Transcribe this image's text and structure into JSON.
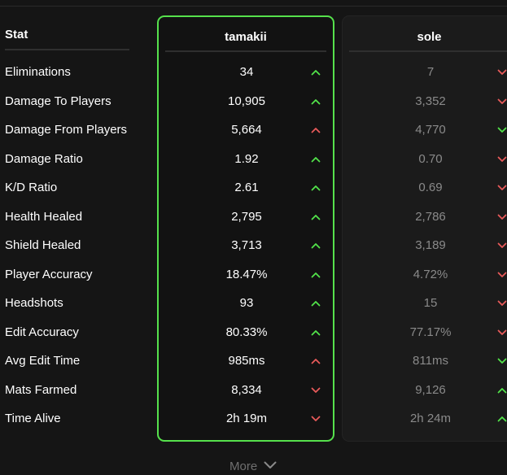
{
  "table": {
    "stat_header": "Stat",
    "players": [
      {
        "name": "tamakii",
        "highlighted": true
      },
      {
        "name": "sole",
        "highlighted": false
      }
    ],
    "rows": [
      {
        "label": "Eliminations",
        "p1": "34",
        "p1_trend": "up",
        "p2": "7",
        "p2_trend": "down"
      },
      {
        "label": "Damage To Players",
        "p1": "10,905",
        "p1_trend": "up",
        "p2": "3,352",
        "p2_trend": "down"
      },
      {
        "label": "Damage From Players",
        "p1": "5,664",
        "p1_trend": "up-bad",
        "p2": "4,770",
        "p2_trend": "down-good"
      },
      {
        "label": "Damage Ratio",
        "p1": "1.92",
        "p1_trend": "up",
        "p2": "0.70",
        "p2_trend": "down"
      },
      {
        "label": "K/D Ratio",
        "p1": "2.61",
        "p1_trend": "up",
        "p2": "0.69",
        "p2_trend": "down"
      },
      {
        "label": "Health Healed",
        "p1": "2,795",
        "p1_trend": "up",
        "p2": "2,786",
        "p2_trend": "down"
      },
      {
        "label": "Shield Healed",
        "p1": "3,713",
        "p1_trend": "up",
        "p2": "3,189",
        "p2_trend": "down"
      },
      {
        "label": "Player Accuracy",
        "p1": "18.47%",
        "p1_trend": "up",
        "p2": "4.72%",
        "p2_trend": "down"
      },
      {
        "label": "Headshots",
        "p1": "93",
        "p1_trend": "up",
        "p2": "15",
        "p2_trend": "down"
      },
      {
        "label": "Edit Accuracy",
        "p1": "80.33%",
        "p1_trend": "up",
        "p2": "77.17%",
        "p2_trend": "down"
      },
      {
        "label": "Avg Edit Time",
        "p1": "985ms",
        "p1_trend": "up-bad",
        "p2": "811ms",
        "p2_trend": "down-good"
      },
      {
        "label": "Mats Farmed",
        "p1": "8,334",
        "p1_trend": "down",
        "p2": "9,126",
        "p2_trend": "up"
      },
      {
        "label": "Time Alive",
        "p1": "2h 19m",
        "p1_trend": "down",
        "p2": "2h 24m",
        "p2_trend": "up"
      }
    ]
  },
  "more": {
    "label": "More",
    "icon": "chevron-down-icon"
  },
  "colors": {
    "background": "#151515",
    "highlight_border": "#56e14c",
    "good": "#52e34a",
    "bad": "#e85a5a",
    "muted_text": "#8a8a8a"
  }
}
